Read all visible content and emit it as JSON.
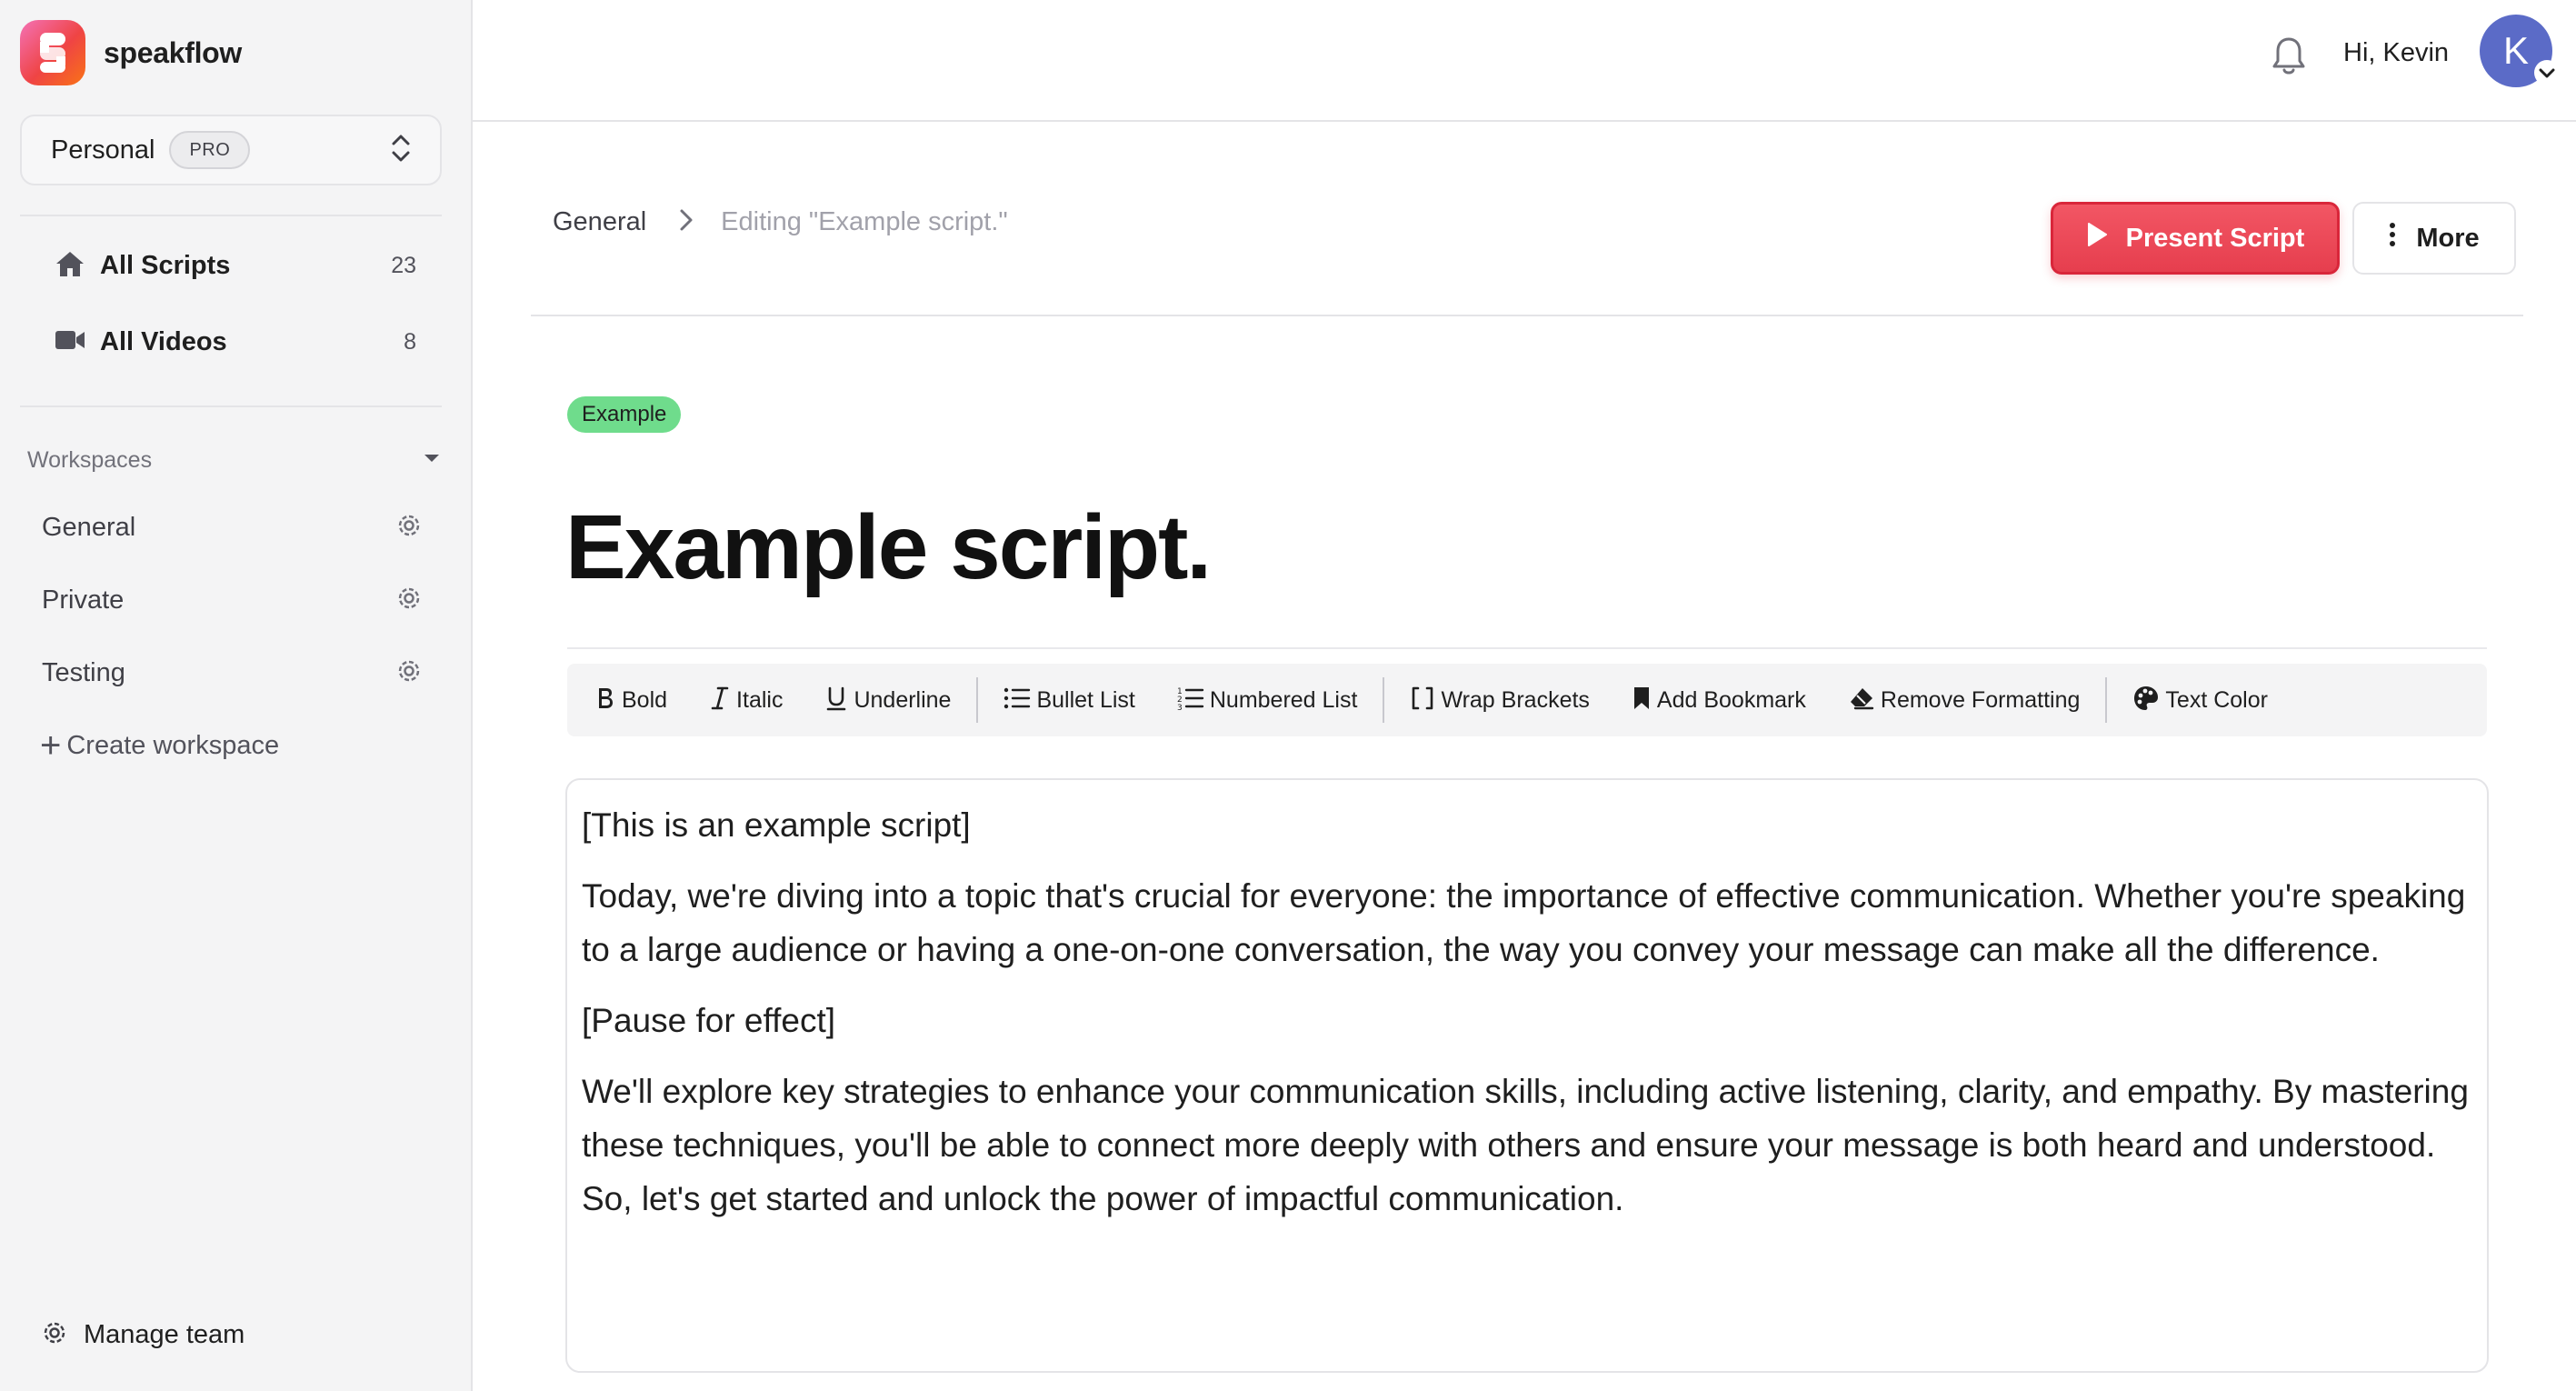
{
  "app": {
    "name": "speakflow"
  },
  "team_switcher": {
    "name": "Personal",
    "badge": "PRO"
  },
  "nav": {
    "all_scripts": {
      "label": "All Scripts",
      "count": "23"
    },
    "all_videos": {
      "label": "All Videos",
      "count": "8"
    }
  },
  "workspaces": {
    "header": "Workspaces",
    "items": [
      {
        "label": "General"
      },
      {
        "label": "Private"
      },
      {
        "label": "Testing"
      }
    ],
    "create_label": "Create workspace"
  },
  "footer": {
    "manage_team": "Manage team"
  },
  "topbar": {
    "greeting": "Hi, Kevin",
    "avatar_initial": "K"
  },
  "breadcrumb": {
    "root": "General",
    "current": "Editing \"Example script.\""
  },
  "actions": {
    "present": "Present Script",
    "more": "More"
  },
  "document": {
    "tag": "Example",
    "title": "Example script.",
    "paragraphs": [
      "[This is an example script]",
      "Today, we're diving into a topic that's crucial for everyone: the importance of effective communication. Whether you're speaking to a large audience or having a one-on-one conversation, the way you convey your message can make all the difference.",
      "[Pause for effect]",
      "We'll explore key strategies to enhance your communication skills, including active listening, clarity, and empathy. By mastering these techniques, you'll be able to connect more deeply with others and ensure your message is both heard and understood. So, let's get started and unlock the power of impactful communication."
    ]
  },
  "toolbar": {
    "bold": "Bold",
    "italic": "Italic",
    "underline": "Underline",
    "bullet_list": "Bullet List",
    "numbered_list": "Numbered List",
    "wrap_brackets": "Wrap Brackets",
    "add_bookmark": "Add Bookmark",
    "remove_formatting": "Remove Formatting",
    "text_color": "Text Color"
  },
  "colors": {
    "accent": "#e63e4e",
    "tag_green": "#6fdc8c",
    "avatar": "#5b6bc7",
    "sidebar_bg": "#f4f4f5"
  }
}
